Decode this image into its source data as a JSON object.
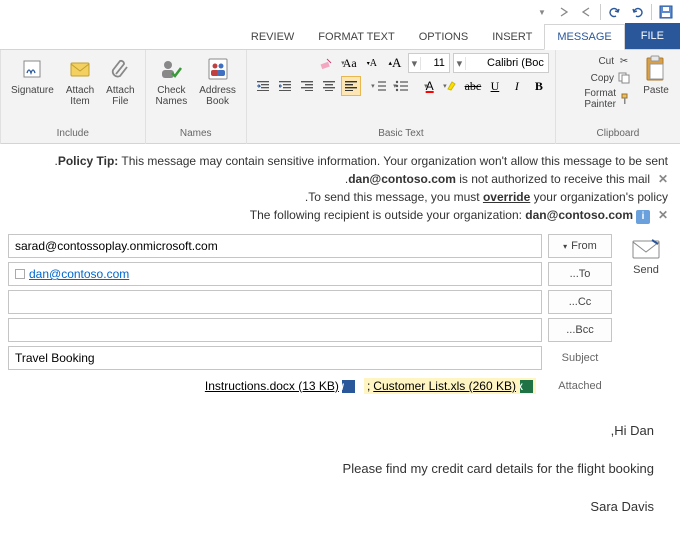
{
  "tabs": {
    "file": "FILE",
    "message": "MESSAGE",
    "insert": "INSERT",
    "options": "OPTIONS",
    "formatText": "FORMAT TEXT",
    "review": "REVIEW"
  },
  "ribbon": {
    "clipboard": {
      "group": "Clipboard",
      "paste": "Paste",
      "cut": "Cut",
      "copy": "Copy",
      "formatPainter": "Format Painter"
    },
    "basicText": {
      "group": "Basic Text",
      "fontName": "Calibri (Boc",
      "fontSize": "11",
      "bold": "B",
      "italic": "I",
      "underline": "U"
    },
    "names": {
      "group": "Names",
      "addressBook": "Address\nBook",
      "checkNames": "Check\nNames"
    },
    "include": {
      "group": "Include",
      "attachFile": "Attach\nFile",
      "attachItem": "Attach\nItem",
      "signature": "Signature"
    }
  },
  "policy": {
    "tipPrefix": "Policy Tip:",
    "tipText": " This message may contain sensitive information. Your organization won't allow this message to be sent.",
    "line2a": "dan@contoso.com",
    "line2b": " is not authorized to receive this mail.",
    "line3a": "To send this message, you must ",
    "line3b": "override",
    "line3c": " your organization's policy.",
    "line4a": "The following recipient is outside your organization: ",
    "line4b": "dan@contoso.com"
  },
  "compose": {
    "send": "Send",
    "from": "From",
    "fromValue": "sarad@contossoplay.onmicrosoft.com",
    "to": "To...",
    "toValue": "dan@contoso.com",
    "cc": "Cc...",
    "ccValue": "",
    "bcc": "Bcc...",
    "bccValue": "",
    "subject": "Subject",
    "subjectValue": "Travel Booking",
    "attached": "Attached",
    "attach1": "Customer List.xls (260 KB)",
    "attach2": "Instructions.docx (13 KB)"
  },
  "body": {
    "p1": "Hi Dan,",
    "p2": "Please find my credit card details for the flight booking",
    "p3": "Sara Davis"
  }
}
